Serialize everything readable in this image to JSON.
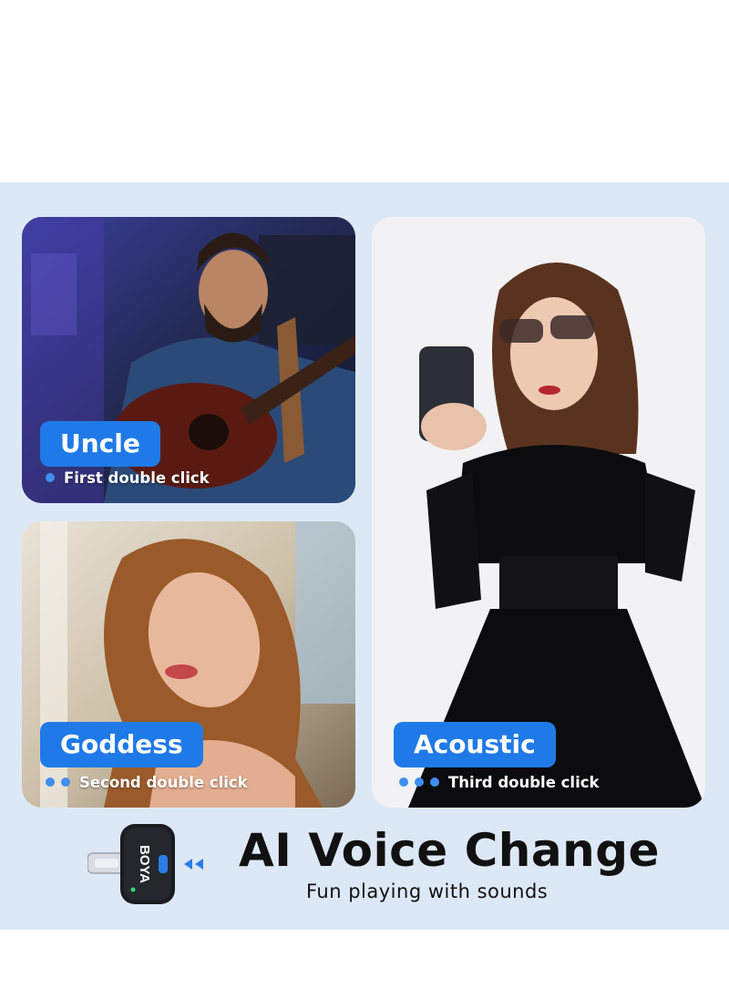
{
  "cards": {
    "uncle": {
      "label": "Uncle",
      "hint": "First double click"
    },
    "goddess": {
      "label": "Goddess",
      "hint": "Second double click"
    },
    "acoustic": {
      "label": "Acoustic",
      "hint": "Third double click"
    }
  },
  "headline": "AI Voice Change",
  "tagline": "Fun playing with sounds",
  "device": {
    "brand": "BOYA",
    "icon": "lightning-microphone-icon"
  },
  "colors": {
    "accent": "#1f7ae8",
    "band": "#dde8f6",
    "text": "#111111"
  }
}
